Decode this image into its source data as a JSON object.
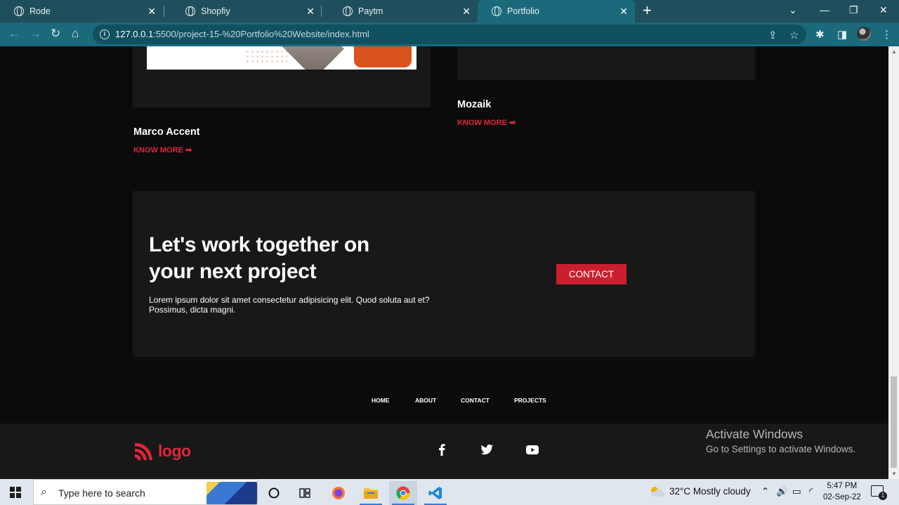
{
  "browser": {
    "tabs": [
      {
        "title": "Rode"
      },
      {
        "title": "Shopfiy"
      },
      {
        "title": "Paytm"
      },
      {
        "title": "Portfolio"
      }
    ],
    "url_host": "127.0.0.1",
    "url_path": ":5500/project-15-%20Portfolio%20Website/index.html"
  },
  "projects": [
    {
      "title": "Marco Accent",
      "link": "KNOW MORE ➡"
    },
    {
      "title": "Mozaik",
      "link": "KNOW MORE ➡"
    }
  ],
  "cta": {
    "heading": "Let's work together on your next project",
    "body": "Lorem ipsum dolor sit amet consectetur adipisicing elit. Quod soluta aut et? Possimus, dicta magni.",
    "button": "CONTACT"
  },
  "footer": {
    "nav": [
      "HOME",
      "ABOUT",
      "CONTACT",
      "PROJECTS"
    ],
    "logo_text": "logo",
    "social": [
      "facebook-icon",
      "twitter-icon",
      "youtube-icon"
    ]
  },
  "watermark": {
    "line1": "Activate Windows",
    "line2": "Go to Settings to activate Windows."
  },
  "taskbar": {
    "search_placeholder": "Type here to search",
    "weather": "32°C  Mostly cloudy",
    "time": "5:47 PM",
    "date": "02-Sep-22",
    "notification_count": "1"
  },
  "colors": {
    "accent": "#e0263a",
    "button": "#cc1f2d",
    "card": "#181818",
    "page": "#0b0b0b",
    "browser_chrome": "#1b6a7c"
  }
}
